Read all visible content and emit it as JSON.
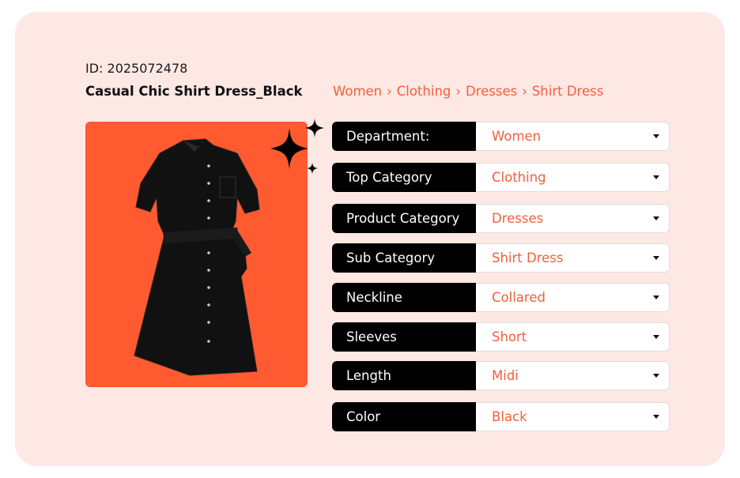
{
  "product": {
    "id_text": "ID: 2025072478",
    "title": "Casual Chic Shirt Dress_Black"
  },
  "breadcrumb": {
    "items": [
      "Women",
      "Clothing",
      "Dresses",
      "Shirt Dress"
    ],
    "separator": "›"
  },
  "image": {
    "icon": "dress-image",
    "background": "#ff5a30"
  },
  "attributes": [
    {
      "label": "Department:",
      "value": "Women"
    },
    {
      "label": "Top Category",
      "value": "Clothing"
    },
    {
      "label": "Product Category",
      "value": "Dresses"
    },
    {
      "label": "Sub Category",
      "value": "Shirt Dress"
    },
    {
      "label": "Neckline",
      "value": "Collared"
    },
    {
      "label": "Sleeves",
      "value": "Short"
    },
    {
      "label": "Length",
      "value": "Midi"
    },
    {
      "label": "Color",
      "value": "Black"
    }
  ],
  "colors": {
    "accent": "#f2603a",
    "card_bg": "#fde8e4",
    "label_bg": "#000000"
  }
}
